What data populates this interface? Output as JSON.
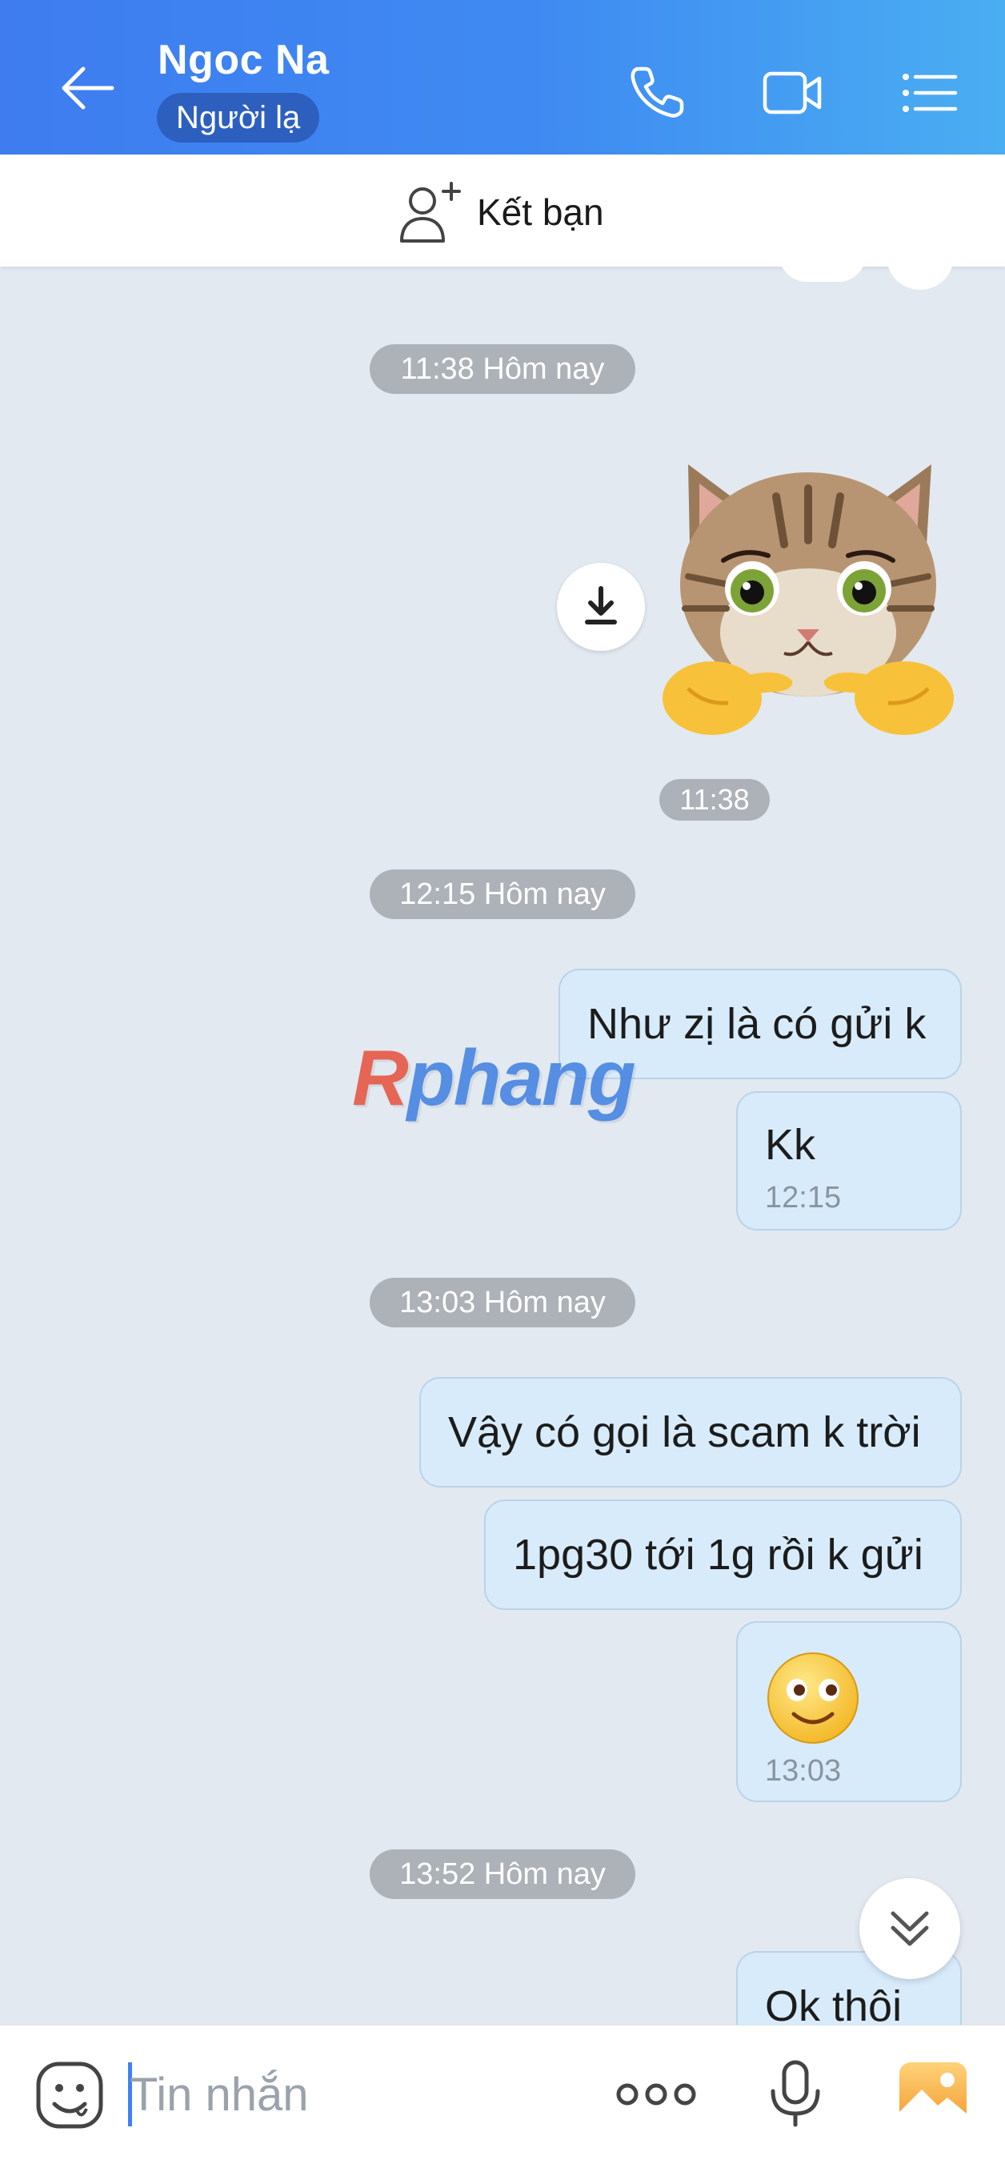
{
  "header": {
    "contact_name": "Ngoc Na",
    "status_badge": "Người lạ",
    "background_colors": [
      "#3e7cf0",
      "#4aaef2"
    ]
  },
  "add_friend": {
    "label": "Kết bạn"
  },
  "chat": {
    "time_dividers": [
      "11:38 Hôm nay",
      "12:15 Hôm nay",
      "13:03 Hôm nay",
      "13:52 Hôm nay"
    ],
    "sticker_time": "11:38",
    "messages": [
      {
        "text": "Như zị là có gửi k"
      },
      {
        "text": "Kk",
        "time": "12:15"
      },
      {
        "text": "Vậy có gọi là scam k trời"
      },
      {
        "text": "1pg30 tới 1g rồi k gửi"
      },
      {
        "emoji": "smiling-face",
        "time": "13:03"
      },
      {
        "text": "Ok thôi"
      }
    ],
    "bubble_color": "#d8ebfb"
  },
  "watermark": {
    "text_a": "R",
    "text_b": "phang"
  },
  "composer": {
    "placeholder": "Tin nhắn"
  },
  "icons": [
    "back-arrow-icon",
    "phone-icon",
    "video-call-icon",
    "menu-list-icon",
    "add-friend-icon",
    "download-icon",
    "chevron-double-down-icon",
    "emoji-icon",
    "more-dots-icon",
    "microphone-icon",
    "image-icon"
  ]
}
